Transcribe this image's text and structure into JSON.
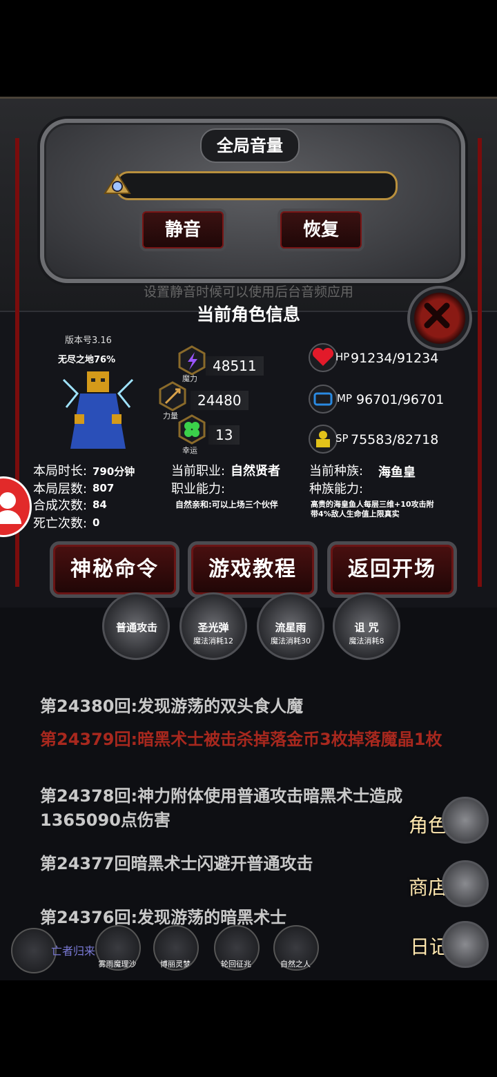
{
  "volume": {
    "title": "全局音量",
    "mute_label": "静音",
    "restore_label": "恢复",
    "hint": "设置静音时候可以使用后台音频应用"
  },
  "character": {
    "title": "当前角色信息",
    "version": "版本号3.16",
    "endless": "无尽之地76%",
    "magic": {
      "value": "48511",
      "label": "魔力"
    },
    "strength": {
      "value": "24480",
      "label": "力量"
    },
    "luck": {
      "value": "13",
      "label": "幸运"
    },
    "hp": {
      "label": "HP",
      "value": "91234/91234"
    },
    "mp": {
      "label": "MP",
      "value": "96701/96701"
    },
    "sp": {
      "label": "SP",
      "value": "75583/82718"
    },
    "stats": [
      {
        "label": "本局时长:",
        "value": "790分钟"
      },
      {
        "label": "本局层数:",
        "value": "807"
      },
      {
        "label": "合成次数:",
        "value": "84"
      },
      {
        "label": "死亡次数:",
        "value": "0"
      }
    ],
    "job_label": "当前职业:",
    "job_value": "自然贤者",
    "job_ability_label": "职业能力:",
    "job_ability": "自然亲和:可以上场三个伙伴",
    "race_label": "当前种族:",
    "race_value": "海鱼皇",
    "race_ability_label": "种族能力:",
    "race_ability": "高贵的海皇鱼人每层三维+10攻击附带4%敌人生命值上限真实",
    "buttons": {
      "secret": "神秘命令",
      "tutorial": "游戏教程",
      "back": "返回开场"
    }
  },
  "skills": [
    {
      "name": "普通攻击",
      "cost": ""
    },
    {
      "name": "圣光弹",
      "cost": "魔法消耗12"
    },
    {
      "name": "流星雨",
      "cost": "魔法消耗30"
    },
    {
      "name": "诅 咒",
      "cost": "魔法消耗8"
    }
  ],
  "log": [
    "第24380回:发现游荡的双头食人魔",
    "第24379回:暗黑术士被击杀掉落金币3枚掉落魔晶1枚",
    "第24378回:神力附体使用普通攻击暗黑术士造成1365090点伤害",
    "第24377回暗黑术士闪避开普通攻击",
    "第24376回:发现游荡的暗黑术士"
  ],
  "side_buttons": {
    "role": "角色",
    "shop": "商店",
    "diary": "日记"
  },
  "party": {
    "leader_label": "亡者归来",
    "members": [
      "雾雨魔理沙",
      "博丽灵梦",
      "轮回征兆",
      "自然之人"
    ]
  },
  "colors": {
    "accent_red": "#a8281e",
    "gold": "#b9903d"
  }
}
